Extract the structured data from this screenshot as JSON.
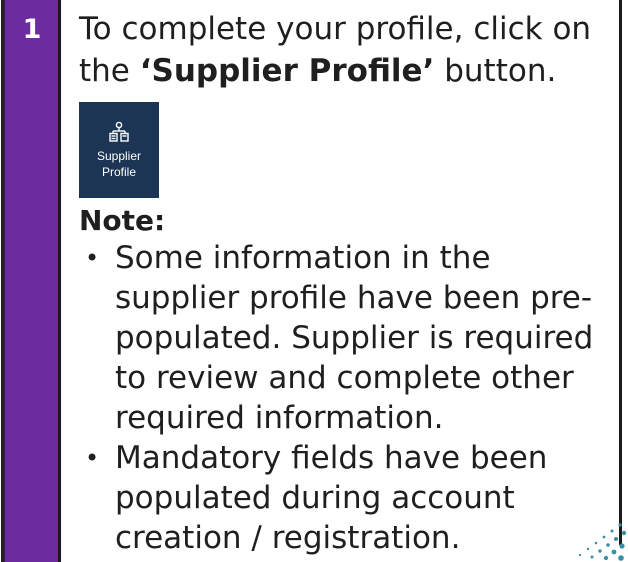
{
  "step": {
    "number": "1"
  },
  "intro": {
    "prefix": "To complete your profile, click on the ",
    "button_name": "‘Supplier Profile’",
    "suffix": " button."
  },
  "supplier_button": {
    "line1": "Supplier",
    "line2": "Profile",
    "icon": "org-chart-icon",
    "background": "#1c3555"
  },
  "note": {
    "title": "Note:",
    "items": [
      "Some information in the supplier profile have been pre-populated. Supplier is required to review and complete other required information.",
      "Mandatory fields have been populated during account creation / registration."
    ]
  },
  "colors": {
    "step_column": "#6b2c9f",
    "dots": "#3a8fa8"
  }
}
